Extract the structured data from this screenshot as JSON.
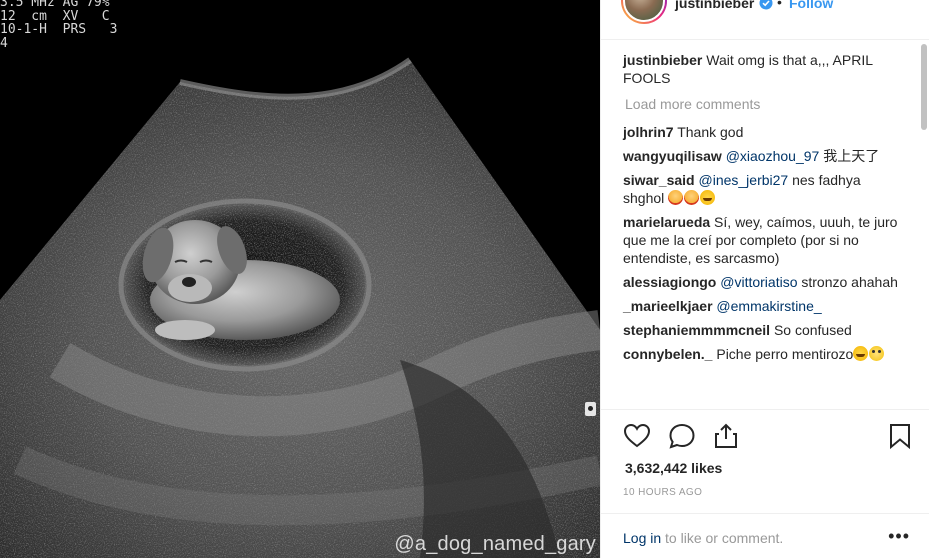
{
  "photo": {
    "readout_lines": [
      "3.5 MHz AG 79%",
      "12  cm  XV   C",
      "10-1-H  PRS   3",
      "4"
    ],
    "watermark": "@a_dog_named_gary"
  },
  "header": {
    "username": "justinbieber",
    "dot": "•",
    "follow_label": "Follow"
  },
  "caption": {
    "user": "justinbieber",
    "text": " Wait omg is that a,,, APRIL FOOLS"
  },
  "load_more_label": "Load more comments",
  "comments": [
    {
      "user": "jolhrin7",
      "parts": [
        {
          "t": " Thank god"
        }
      ]
    },
    {
      "user": "wangyuqilisaw",
      "parts": [
        {
          "t": " "
        },
        {
          "m": "@xiaozhou_97"
        },
        {
          "t": " 我上天了"
        }
      ]
    },
    {
      "user": "siwar_said",
      "parts": [
        {
          "t": " "
        },
        {
          "m": "@ines_jerbi27"
        },
        {
          "t": " nes fadhya shghol "
        }
      ],
      "emojis": [
        "woman",
        "woman",
        "tears"
      ]
    },
    {
      "user": "marielarueda",
      "parts": [
        {
          "t": " Sí, wey, caímos, uuuh, te juro que me la creí por completo (por si no entendiste, es sarcasmo)"
        }
      ]
    },
    {
      "user": "alessiagiongo",
      "parts": [
        {
          "t": " "
        },
        {
          "m": "@vittoriatiso"
        },
        {
          "t": " stronzo ahahah"
        }
      ]
    },
    {
      "user": "_marieelkjaer",
      "parts": [
        {
          "t": " "
        },
        {
          "m": "@emmakirstine_"
        }
      ]
    },
    {
      "user": "stephaniemmmmcneil",
      "parts": [
        {
          "t": " So confused"
        }
      ]
    },
    {
      "user": "connybelen._",
      "parts": [
        {
          "t": " Piche perro mentirozo"
        }
      ],
      "emojis": [
        "tears",
        "roll"
      ]
    }
  ],
  "likes_text": "3,632,442 likes",
  "timestamp": "10 HOURS AGO",
  "login": {
    "link": "Log in",
    "rest": " to like or comment."
  },
  "more_label": "•••",
  "colors": {
    "link": "#003569",
    "follow": "#3897f0",
    "muted": "#999999",
    "text": "#262626"
  },
  "icons": [
    "heart-icon",
    "comment-icon",
    "share-icon",
    "bookmark-icon",
    "verified-badge-icon",
    "more-options-icon"
  ]
}
